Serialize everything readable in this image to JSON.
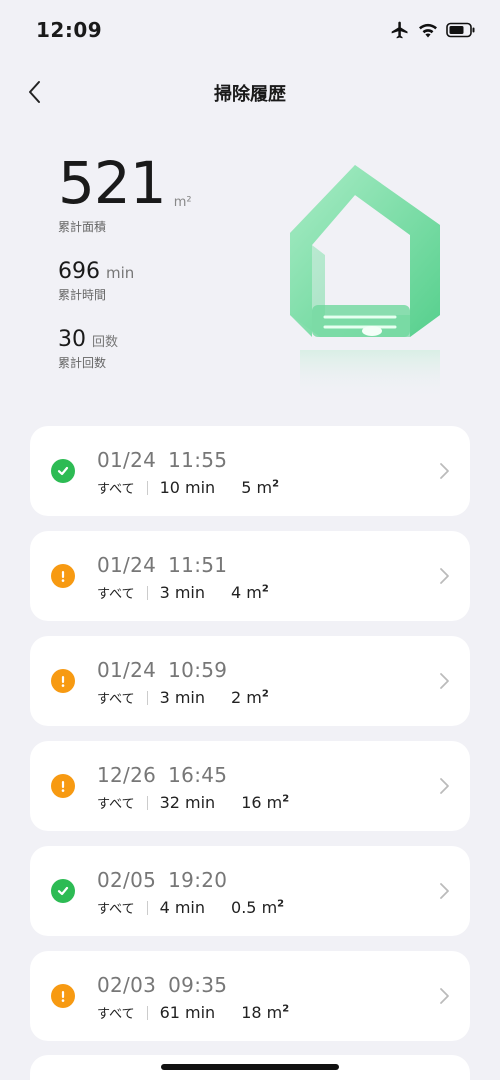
{
  "status_bar": {
    "time": "12:09",
    "icons": [
      "airplane-icon",
      "wifi-icon",
      "battery-icon"
    ]
  },
  "nav": {
    "title": "掃除履歴",
    "back_icon": "chevron-left-icon"
  },
  "summary": {
    "area_value": "521",
    "area_unit": "m²",
    "area_label": "累計面積",
    "time_value": "696",
    "time_unit": "min",
    "time_label": "累計時間",
    "count_value": "30",
    "count_unit": "回数",
    "count_label": "累計回数"
  },
  "colors": {
    "background": "#f1f1f6",
    "success": "#2dbb54",
    "warning": "#f79a12",
    "card": "#ffffff"
  },
  "records": [
    {
      "date": "01/24",
      "time": "11:55",
      "mode": "すべて",
      "duration": "10 min",
      "area_num": "5",
      "area_unit": "m",
      "area_sup": "2",
      "status": "ok"
    },
    {
      "date": "01/24",
      "time": "11:51",
      "mode": "すべて",
      "duration": "3 min",
      "area_num": "4",
      "area_unit": "m",
      "area_sup": "2",
      "status": "warn"
    },
    {
      "date": "01/24",
      "time": "10:59",
      "mode": "すべて",
      "duration": "3 min",
      "area_num": "2",
      "area_unit": "m",
      "area_sup": "2",
      "status": "warn"
    },
    {
      "date": "12/26",
      "time": "16:45",
      "mode": "すべて",
      "duration": "32 min",
      "area_num": "16",
      "area_unit": "m",
      "area_sup": "2",
      "status": "warn"
    },
    {
      "date": "02/05",
      "time": "19:20",
      "mode": "すべて",
      "duration": "4 min",
      "area_num": "0.5",
      "area_unit": "m",
      "area_sup": "2",
      "status": "ok"
    },
    {
      "date": "02/03",
      "time": "09:35",
      "mode": "すべて",
      "duration": "61 min",
      "area_num": "18",
      "area_unit": "m",
      "area_sup": "2",
      "status": "warn"
    }
  ]
}
